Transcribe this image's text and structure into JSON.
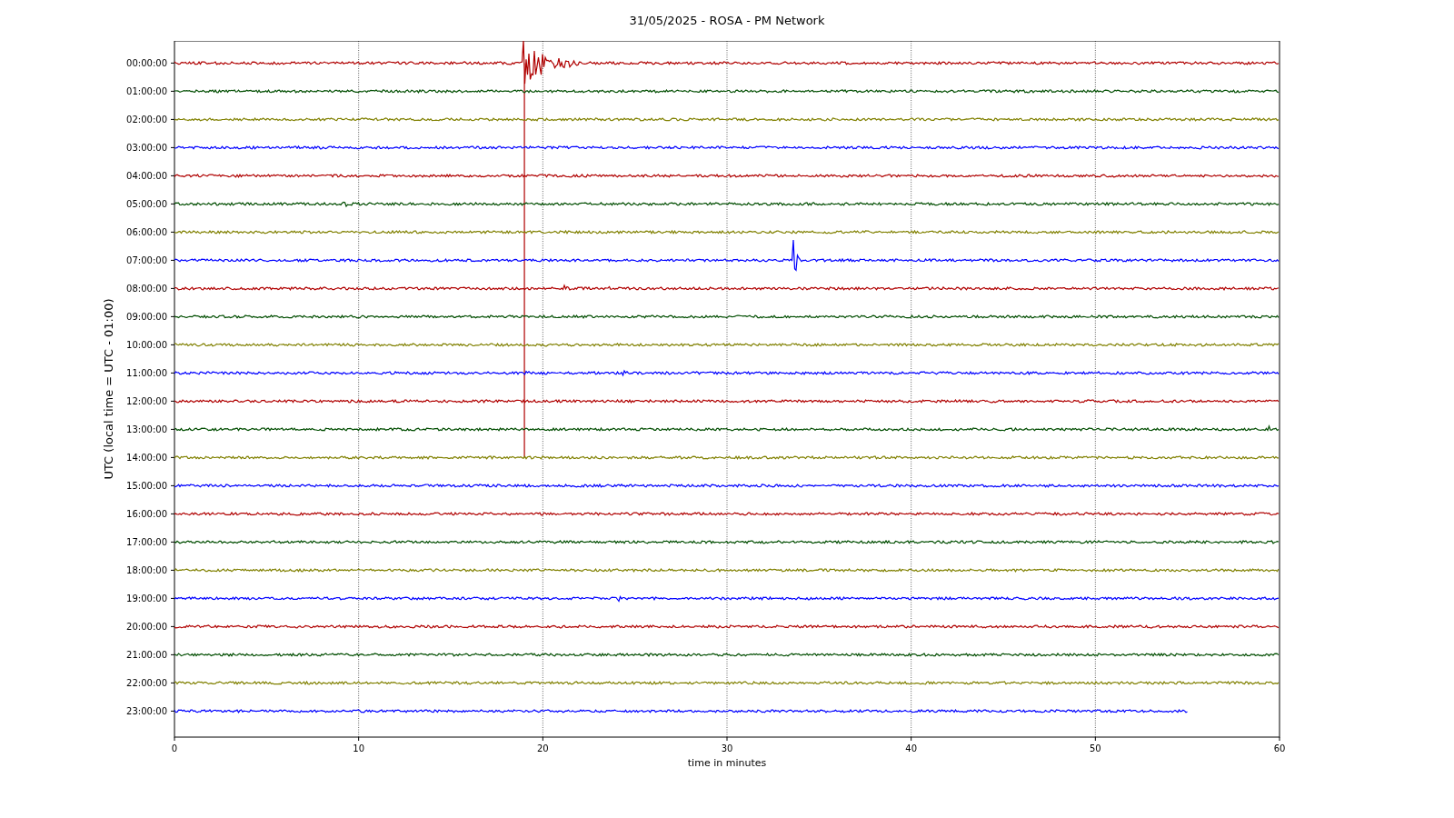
{
  "plot": {
    "title": "31/05/2025 - ROSA - PM Network",
    "xlabel": "time in minutes",
    "ylabel": "UTC (local time = UTC - 01:00)",
    "xticks": [
      "0",
      "10",
      "20",
      "30",
      "40",
      "50",
      "60"
    ],
    "rows": [
      {
        "label": "00:00:00",
        "color": "#b00000"
      },
      {
        "label": "01:00:00",
        "color": "#004d00"
      },
      {
        "label": "02:00:00",
        "color": "#808000"
      },
      {
        "label": "03:00:00",
        "color": "#0000ff"
      },
      {
        "label": "04:00:00",
        "color": "#b00000"
      },
      {
        "label": "05:00:00",
        "color": "#004d00"
      },
      {
        "label": "06:00:00",
        "color": "#808000"
      },
      {
        "label": "07:00:00",
        "color": "#0000ff"
      },
      {
        "label": "08:00:00",
        "color": "#b00000"
      },
      {
        "label": "09:00:00",
        "color": "#004d00"
      },
      {
        "label": "10:00:00",
        "color": "#808000"
      },
      {
        "label": "11:00:00",
        "color": "#0000ff"
      },
      {
        "label": "12:00:00",
        "color": "#b00000"
      },
      {
        "label": "13:00:00",
        "color": "#004d00"
      },
      {
        "label": "14:00:00",
        "color": "#808000"
      },
      {
        "label": "15:00:00",
        "color": "#0000ff"
      },
      {
        "label": "16:00:00",
        "color": "#b00000"
      },
      {
        "label": "17:00:00",
        "color": "#004d00"
      },
      {
        "label": "18:00:00",
        "color": "#808000"
      },
      {
        "label": "19:00:00",
        "color": "#0000ff"
      },
      {
        "label": "20:00:00",
        "color": "#b00000"
      },
      {
        "label": "21:00:00",
        "color": "#004d00"
      },
      {
        "label": "22:00:00",
        "color": "#808000"
      },
      {
        "label": "23:00:00",
        "color": "#0000ff"
      }
    ]
  }
}
